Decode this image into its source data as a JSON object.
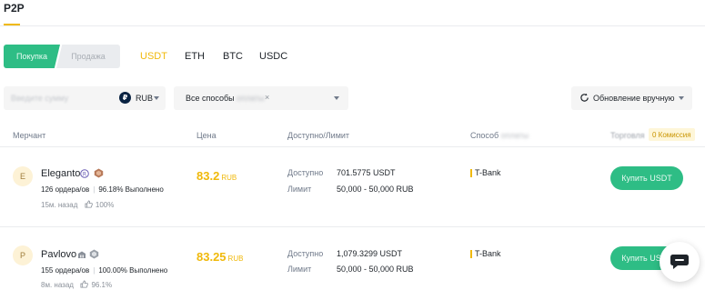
{
  "header": {
    "tab": "P2P"
  },
  "trade_side": {
    "buy": "Покупка",
    "sell": "Продажа"
  },
  "assets": [
    "USDT",
    "ETH",
    "BTC",
    "USDC"
  ],
  "active_asset": "USDT",
  "filters": {
    "amount_placeholder": "Введите сумму",
    "currency": "RUB",
    "currency_icon": "₽",
    "methods_prefix": "Все способы",
    "methods_blur": "оплаты",
    "close_symbol": "×",
    "refresh_label": "Обновление вручную"
  },
  "table_headers": {
    "merchant": "Мерчант",
    "price": "Цена",
    "available": "Доступно/Лимит",
    "payment_prefix": "Способ",
    "payment_blur": "оплаты",
    "trade": "Торговля",
    "fee_badge": "0 Комиссия"
  },
  "ads": [
    {
      "avatar": "E",
      "name": "Eleganto",
      "orders": "126 ордера/ов",
      "completion": "96.18% Выполнено",
      "time": "15м. назад",
      "rating": "100%",
      "price": "83.2",
      "price_currency": "RUB",
      "available_label": "Доступно",
      "available": "701.5775 USDT",
      "limit_label": "Лимит",
      "limit": "50,000 - 50,000 RUB",
      "payment": "T-Bank",
      "button": "Купить USDT"
    },
    {
      "avatar": "P",
      "name": "Pavlovo",
      "orders": "155 ордера/ов",
      "completion": "100.00% Выполнено",
      "time": "8м. назад",
      "rating": "96.1%",
      "price": "83.25",
      "price_currency": "RUB",
      "available_label": "Доступно",
      "available": "1,079.3299 USDT",
      "limit_label": "Лимит",
      "limit": "50,000 - 50,000 RUB",
      "payment": "T-Bank",
      "button": "Купить USDT"
    }
  ],
  "colors": {
    "accent": "#f0b90b",
    "buy_green": "#2ebd85"
  }
}
